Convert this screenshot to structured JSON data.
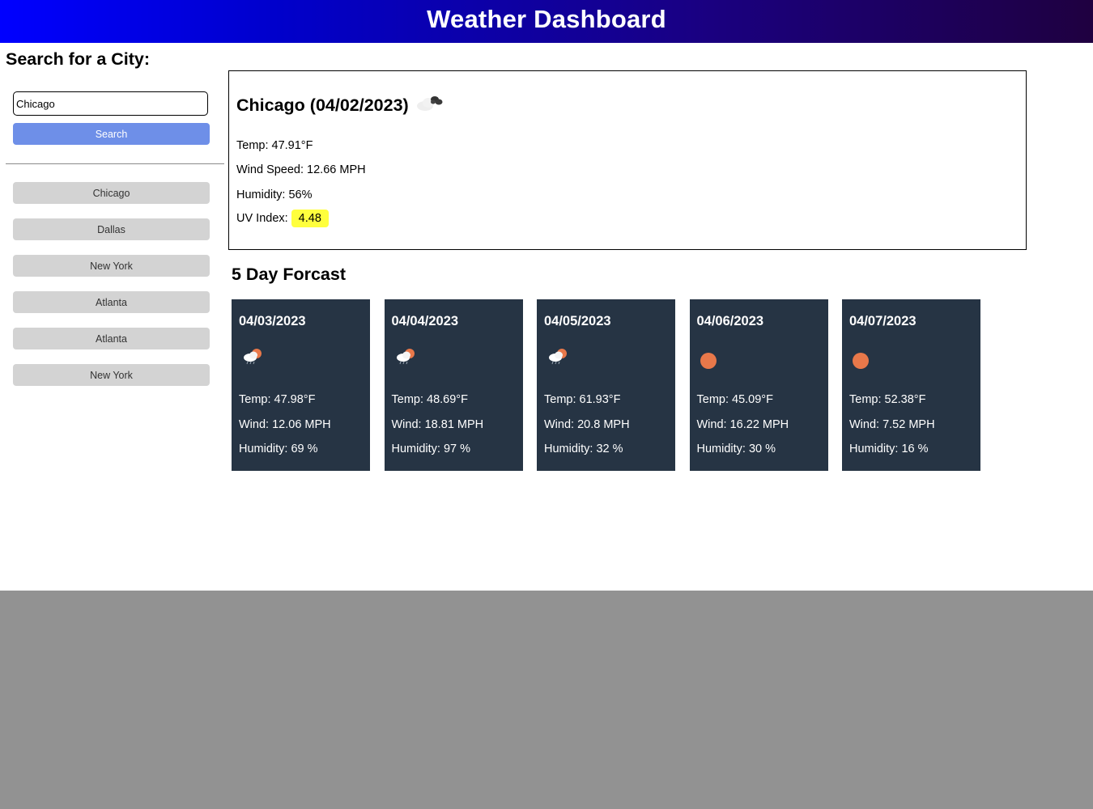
{
  "header": {
    "title": "Weather Dashboard"
  },
  "sidebar": {
    "title": "Search for a City:",
    "search_value": "Chicago",
    "search_button": "Search",
    "history": [
      "Chicago",
      "Dallas",
      "New York",
      "Atlanta",
      "Atlanta",
      "New York"
    ]
  },
  "current": {
    "title": "Chicago (04/02/2023)",
    "icon": "cloudy-icon",
    "temp": "Temp: 47.91°F",
    "wind": "Wind Speed: 12.66 MPH",
    "humidity": "Humidity: 56%",
    "uv_label": "UV Index:",
    "uv_value": "4.48",
    "uv_color": "#ffff3d"
  },
  "forecast": {
    "title": "5 Day Forcast",
    "days": [
      {
        "date": "04/03/2023",
        "icon": "partly-cloudy-rain-icon",
        "temp": "Temp: 47.98°F",
        "wind": "Wind: 12.06 MPH",
        "humidity": "Humidity: 69 %"
      },
      {
        "date": "04/04/2023",
        "icon": "partly-cloudy-rain-icon",
        "temp": "Temp: 48.69°F",
        "wind": "Wind: 18.81 MPH",
        "humidity": "Humidity: 97 %"
      },
      {
        "date": "04/05/2023",
        "icon": "partly-cloudy-rain-icon",
        "temp": "Temp: 61.93°F",
        "wind": "Wind: 20.8 MPH",
        "humidity": "Humidity: 32 %"
      },
      {
        "date": "04/06/2023",
        "icon": "sun-icon",
        "temp": "Temp: 45.09°F",
        "wind": "Wind: 16.22 MPH",
        "humidity": "Humidity: 30 %"
      },
      {
        "date": "04/07/2023",
        "icon": "sun-icon",
        "temp": "Temp: 52.38°F",
        "wind": "Wind: 7.52 MPH",
        "humidity": "Humidity: 16 %"
      }
    ]
  },
  "colors": {
    "header_gradient_start": "#0000ff",
    "header_gradient_end": "#1f0040",
    "search_button": "#6e8fe8",
    "history_button": "#d3d3d3",
    "forecast_card": "#263444",
    "sun": "#e8784a"
  }
}
